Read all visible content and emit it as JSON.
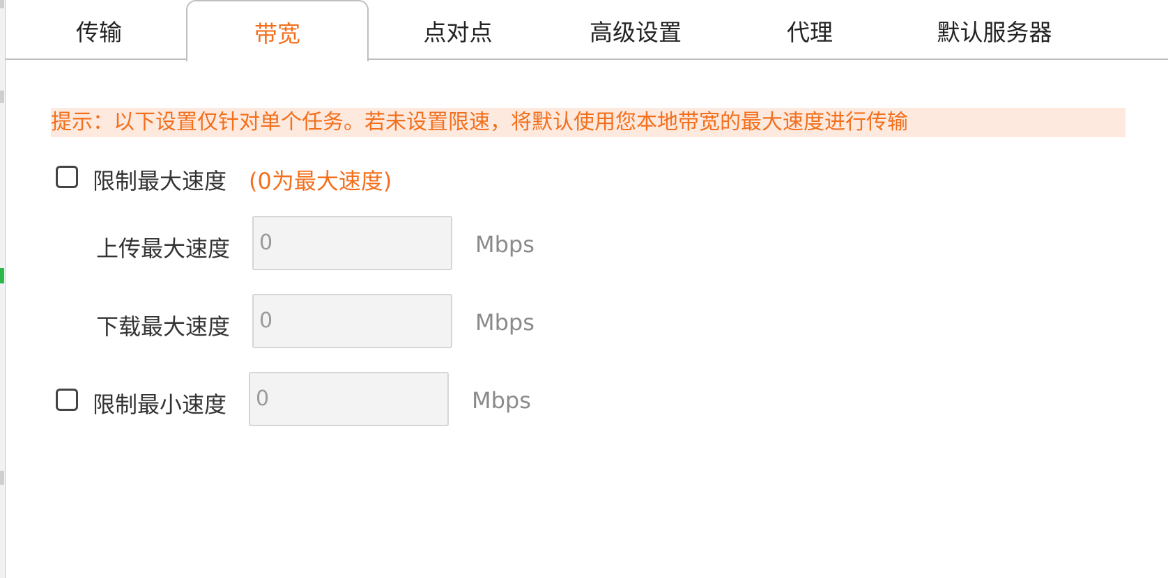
{
  "tabs": [
    {
      "label": "传输",
      "active": false
    },
    {
      "label": "带宽",
      "active": true
    },
    {
      "label": "点对点",
      "active": false
    },
    {
      "label": "高级设置",
      "active": false
    },
    {
      "label": "代理",
      "active": false
    },
    {
      "label": "默认服务器",
      "active": false
    }
  ],
  "hint": "提示：以下设置仅针对单个任务。若未设置限速，将默认使用您本地带宽的最大速度进行传输",
  "limit_max": {
    "checked": false,
    "label": "限制最大速度",
    "note": "(0为最大速度)",
    "upload_label": "上传最大速度",
    "upload_value": "0",
    "download_label": "下载最大速度",
    "download_value": "0",
    "unit": "Mbps"
  },
  "limit_min": {
    "checked": false,
    "label": "限制最小速度",
    "value": "0",
    "unit": "Mbps"
  },
  "colors": {
    "accent": "#f36f1c",
    "hint_bg": "#fde9de"
  }
}
